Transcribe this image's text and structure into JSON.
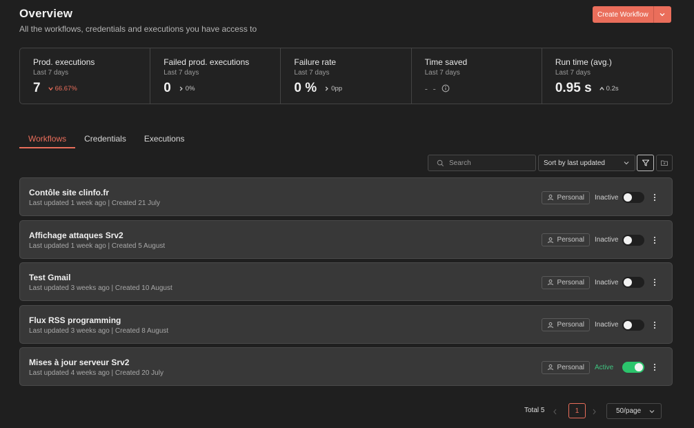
{
  "header": {
    "title": "Overview",
    "subtitle": "All the workflows, credentials and executions you have access to",
    "create_label": "Create Workflow"
  },
  "colors": {
    "accent": "#ea6e5b",
    "active": "#2bc46c",
    "background": "#1f1f1f",
    "card": "#383838"
  },
  "stats": [
    {
      "title": "Prod. executions",
      "period": "Last 7 days",
      "value": "7",
      "delta": "66.67%",
      "delta_dir": "down-icon"
    },
    {
      "title": "Failed prod. executions",
      "period": "Last 7 days",
      "value": "0",
      "delta": "0%",
      "delta_dir": "chevron-right-icon"
    },
    {
      "title": "Failure rate",
      "period": "Last 7 days",
      "value": "0 %",
      "delta": "0pp",
      "delta_dir": "chevron-right-icon"
    },
    {
      "title": "Time saved",
      "period": "Last 7 days",
      "value": "- -",
      "delta": "",
      "delta_dir": "info-icon"
    },
    {
      "title": "Run time (avg.)",
      "period": "Last 7 days",
      "value": "0.95 s",
      "delta": "0.2s",
      "delta_dir": "up-icon"
    }
  ],
  "tabs": [
    "Workflows",
    "Credentials",
    "Executions"
  ],
  "toolbar": {
    "search_placeholder": "Search",
    "sort_label": "Sort by last updated"
  },
  "workflows": [
    {
      "name": "Contôle site clinfo.fr",
      "meta": "Last updated 1 week ago | Created 21 July",
      "badge": "Personal",
      "status": "Inactive",
      "active": false
    },
    {
      "name": "Affichage attaques Srv2",
      "meta": "Last updated 1 week ago | Created 5 August",
      "badge": "Personal",
      "status": "Inactive",
      "active": false
    },
    {
      "name": "Test Gmail",
      "meta": "Last updated 3 weeks ago | Created 10 August",
      "badge": "Personal",
      "status": "Inactive",
      "active": false
    },
    {
      "name": "Flux RSS programming",
      "meta": "Last updated 3 weeks ago | Created 8 August",
      "badge": "Personal",
      "status": "Inactive",
      "active": false
    },
    {
      "name": "Mises à jour serveur Srv2",
      "meta": "Last updated 4 weeks ago | Created 20 July",
      "badge": "Personal",
      "status": "Active",
      "active": true
    }
  ],
  "pagination": {
    "total": "Total 5",
    "current_page": "1",
    "per_page": "50/page"
  }
}
